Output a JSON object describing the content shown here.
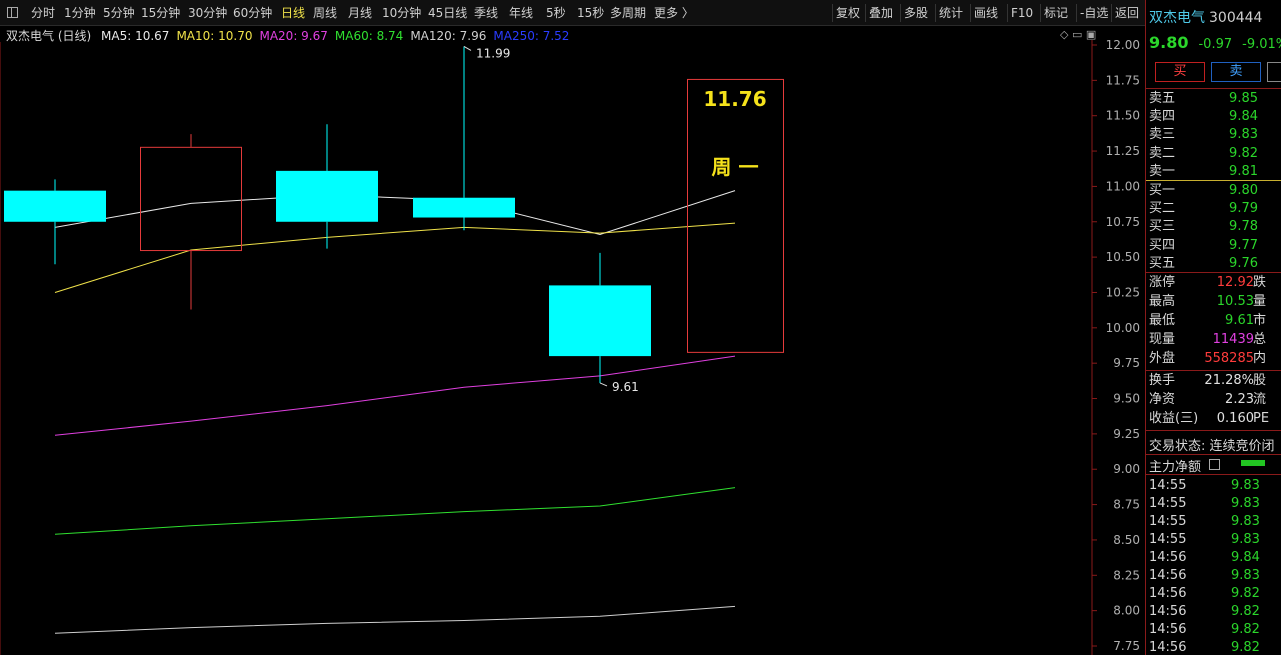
{
  "toolbar": {
    "left_items": [
      "分时",
      "1分钟",
      "5分钟",
      "15分钟",
      "30分钟",
      "60分钟",
      "日线",
      "周线",
      "月线",
      "10分钟",
      "45日线",
      "季线",
      "年线",
      "5秒",
      "15秒",
      "多周期",
      "更多 〉"
    ],
    "active_item": "日线",
    "right_items": [
      "复权",
      "叠加",
      "多股",
      "统计",
      "画线",
      "F10",
      "标记",
      "-自选",
      "返回"
    ]
  },
  "legend": {
    "stock": "双杰电气 (日线)",
    "items": [
      {
        "label": "MA5: 10.67",
        "color": "#e8e8e8"
      },
      {
        "label": "MA10: 10.70",
        "color": "#f0e24a"
      },
      {
        "label": "MA20: 9.67",
        "color": "#e040e0"
      },
      {
        "label": "MA60: 8.74",
        "color": "#30e030"
      },
      {
        "label": "MA120: 7.96",
        "color": "#cfcfcf"
      },
      {
        "label": "MA250: 7.52",
        "color": "#2a3cff"
      }
    ]
  },
  "chart_data": {
    "type": "candlestick",
    "y_axis": {
      "min": 7.75,
      "max": 12.0,
      "ticks": [
        12.0,
        11.75,
        11.5,
        11.25,
        11.0,
        10.75,
        10.5,
        10.25,
        10.0,
        9.75,
        9.5,
        9.25,
        9.0,
        8.75,
        8.5,
        8.25,
        8.0,
        7.75
      ]
    },
    "candles": [
      {
        "open": 10.97,
        "high": 11.05,
        "low": 10.45,
        "close": 10.75,
        "color": "cyan",
        "partial_left": true
      },
      {
        "open": 10.55,
        "high": 11.37,
        "low": 10.13,
        "close": 11.28,
        "color": "red"
      },
      {
        "open": 11.11,
        "high": 11.44,
        "low": 10.56,
        "close": 10.75,
        "color": "cyan"
      },
      {
        "open": 10.92,
        "high": 11.99,
        "low": 10.69,
        "close": 10.78,
        "color": "cyan"
      },
      {
        "open": 10.3,
        "high": 10.53,
        "low": 9.61,
        "close": 9.8,
        "color": "cyan"
      }
    ],
    "hover_bar": {
      "label": "11.76",
      "weekday": "周 一",
      "top": 11.76,
      "bottom": 9.83
    },
    "annotations": [
      {
        "text": "11.99",
        "candle": 3,
        "value": 11.99
      },
      {
        "text": "9.61",
        "candle": 4,
        "value": 9.61
      }
    ],
    "series": [
      {
        "name": "MA5",
        "color": "#e8e8e8",
        "values": [
          10.71,
          10.88,
          10.94,
          10.9,
          10.66,
          10.97
        ]
      },
      {
        "name": "MA10",
        "color": "#f0e24a",
        "values": [
          10.25,
          10.55,
          10.64,
          10.71,
          10.67,
          10.74
        ]
      },
      {
        "name": "MA20",
        "color": "#e040e0",
        "values": [
          9.24,
          9.34,
          9.45,
          9.58,
          9.66,
          9.8
        ]
      },
      {
        "name": "MA60",
        "color": "#30e030",
        "values": [
          8.54,
          8.6,
          8.65,
          8.7,
          8.74,
          8.87
        ]
      },
      {
        "name": "MA120",
        "color": "#cfcfcf",
        "values": [
          7.84,
          7.88,
          7.91,
          7.93,
          7.96,
          8.03
        ]
      }
    ]
  },
  "panel": {
    "name": "双杰电气",
    "code": "300444",
    "price": "9.80",
    "change": "-0.97",
    "change_pct": "-9.01%",
    "buy_label": "买",
    "sell_label": "卖",
    "asks": [
      {
        "label": "卖五",
        "price": "9.85"
      },
      {
        "label": "卖四",
        "price": "9.84"
      },
      {
        "label": "卖三",
        "price": "9.83"
      },
      {
        "label": "卖二",
        "price": "9.82"
      },
      {
        "label": "卖一",
        "price": "9.81"
      }
    ],
    "bids": [
      {
        "label": "买一",
        "price": "9.80"
      },
      {
        "label": "买二",
        "price": "9.79"
      },
      {
        "label": "买三",
        "price": "9.78"
      },
      {
        "label": "买四",
        "price": "9.77"
      },
      {
        "label": "买五",
        "price": "9.76"
      }
    ],
    "stats": [
      {
        "label": "涨停",
        "value": "12.92",
        "color": "red",
        "extra": "跌"
      },
      {
        "label": "最高",
        "value": "10.53",
        "color": "green",
        "extra": "量"
      },
      {
        "label": "最低",
        "value": "9.61",
        "color": "green",
        "extra": "市"
      },
      {
        "label": "现量",
        "value": "11439",
        "color": "magenta",
        "extra": "总"
      },
      {
        "label": "外盘",
        "value": "558285",
        "color": "red",
        "extra": "内"
      }
    ],
    "stats2": [
      {
        "label": "换手",
        "value": "21.28%",
        "extra": "股"
      },
      {
        "label": "净资",
        "value": "2.23",
        "extra": "流"
      },
      {
        "label": "收益(三)",
        "value": "0.160",
        "extra": "PE"
      }
    ],
    "status": "交易状态: 连续竞价闭",
    "flow_label": "主力净额",
    "ticks": [
      {
        "time": "14:55",
        "price": "9.83"
      },
      {
        "time": "14:55",
        "price": "9.83"
      },
      {
        "time": "14:55",
        "price": "9.83"
      },
      {
        "time": "14:55",
        "price": "9.83"
      },
      {
        "time": "14:56",
        "price": "9.84"
      },
      {
        "time": "14:56",
        "price": "9.83"
      },
      {
        "time": "14:56",
        "price": "9.82"
      },
      {
        "time": "14:56",
        "price": "9.82"
      },
      {
        "time": "14:56",
        "price": "9.82"
      },
      {
        "time": "14:56",
        "price": "9.82"
      }
    ]
  }
}
